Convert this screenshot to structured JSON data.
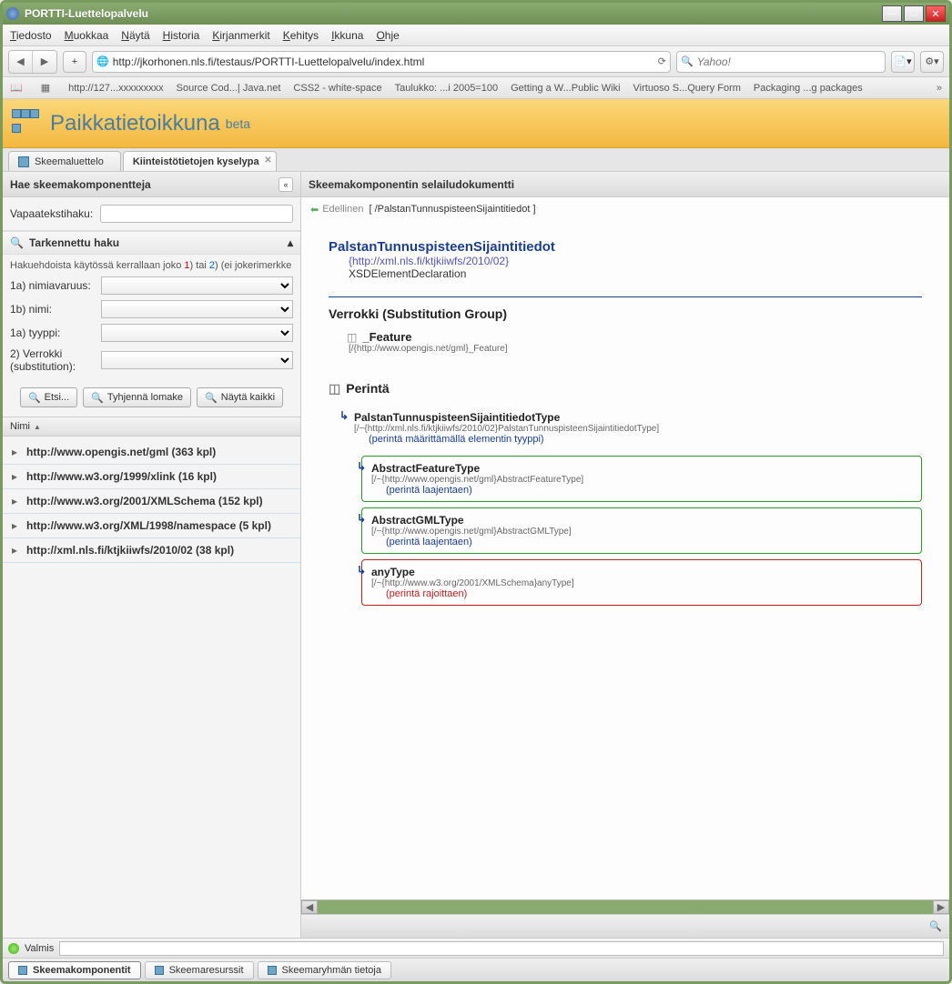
{
  "window": {
    "title": "PORTTI-Luettelopalvelu"
  },
  "menus": [
    "Tiedosto",
    "Muokkaa",
    "Näytä",
    "Historia",
    "Kirjanmerkit",
    "Kehitys",
    "Ikkuna",
    "Ohje"
  ],
  "url": "http://jkorhonen.nls.fi/testaus/PORTTI-Luettelopalvelu/index.html",
  "search_placeholder": "Yahoo!",
  "bookmarks": [
    "http://127...xxxxxxxxx",
    "Source Cod...| Java.net",
    "CSS2 - white-space",
    "Taulukko: ...i 2005=100",
    "Getting a W...Public Wiki",
    "Virtuoso S...Query Form",
    "Packaging ...g packages"
  ],
  "app": {
    "title": "Paikkatietoikkuna",
    "beta": "beta"
  },
  "tabs": [
    {
      "label": "Skeemaluettelo",
      "active": false
    },
    {
      "label": "Kiinteistötietojen kyselypa",
      "active": true
    }
  ],
  "left": {
    "header": "Hae skeemakomponentteja",
    "freetext_label": "Vapaatekstihaku:",
    "adv_title": "Tarkennettu haku",
    "adv_hint_pre": "Hakuehdoista käytössä kerrallaan joko ",
    "adv_hint_mid1": "1",
    "adv_hint_mid2": ") tai ",
    "adv_hint_mid3": "2",
    "adv_hint_post": ") (ei jokerimerkke",
    "fields": {
      "ns": "1a) nimiavaruus:",
      "name": "1b) nimi:",
      "type": "1a) tyyppi:",
      "subst": "2) Verrokki (substitution):"
    },
    "buttons": {
      "search": "Etsi...",
      "clear": "Tyhjennä lomake",
      "all": "Näytä kaikki"
    },
    "grid_header": "Nimi",
    "tree": [
      "http://www.opengis.net/gml (363 kpl)",
      "http://www.w3.org/1999/xlink (16 kpl)",
      "http://www.w3.org/2001/XMLSchema (152 kpl)",
      "http://www.w3.org/XML/1998/namespace (5 kpl)",
      "http://xml.nls.fi/ktjkiiwfs/2010/02 (38 kpl)"
    ]
  },
  "right": {
    "header": "Skeemakomponentin selailudokumentti",
    "prev": "Edellinen",
    "crumb": "[ /PalstanTunnuspisteenSijaintitiedot ]",
    "element": {
      "name": "PalstanTunnuspisteenSijaintitiedot",
      "ns": "{http://xml.nls.fi/ktjkiiwfs/2010/02}",
      "kind": "XSDElementDeclaration"
    },
    "subst_title": "Verrokki (Substitution Group)",
    "subst": {
      "name": "_Feature",
      "path": "[/{http://www.opengis.net/gml}_Feature]"
    },
    "inherit_title": "Perintä",
    "inherit": [
      {
        "name": "PalstanTunnuspisteenSijaintitiedotType",
        "path": "[/~{http://xml.nls.fi/ktjkiiwfs/2010/02}PalstanTunnuspisteenSijaintitiedotType]",
        "note": "(perintä määrittämällä elementin tyyppi)",
        "box": "none",
        "color": "blue"
      },
      {
        "name": "AbstractFeatureType",
        "path": "[/~{http://www.opengis.net/gml}AbstractFeatureType]",
        "note": "(perintä laajentaen)",
        "box": "green",
        "color": "blue"
      },
      {
        "name": "AbstractGMLType",
        "path": "[/~{http://www.opengis.net/gml}AbstractGMLType]",
        "note": "(perintä laajentaen)",
        "box": "green",
        "color": "blue"
      },
      {
        "name": "anyType",
        "path": "[/~{http://www.w3.org/2001/XMLSchema}anyType]",
        "note": "(perintä rajoittaen)",
        "box": "red",
        "color": "red"
      }
    ]
  },
  "status": "Valmis",
  "bottom_tabs": [
    {
      "label": "Skeemakomponentit",
      "active": true
    },
    {
      "label": "Skeemaresurssit",
      "active": false
    },
    {
      "label": "Skeemaryhmän tietoja",
      "active": false
    }
  ]
}
